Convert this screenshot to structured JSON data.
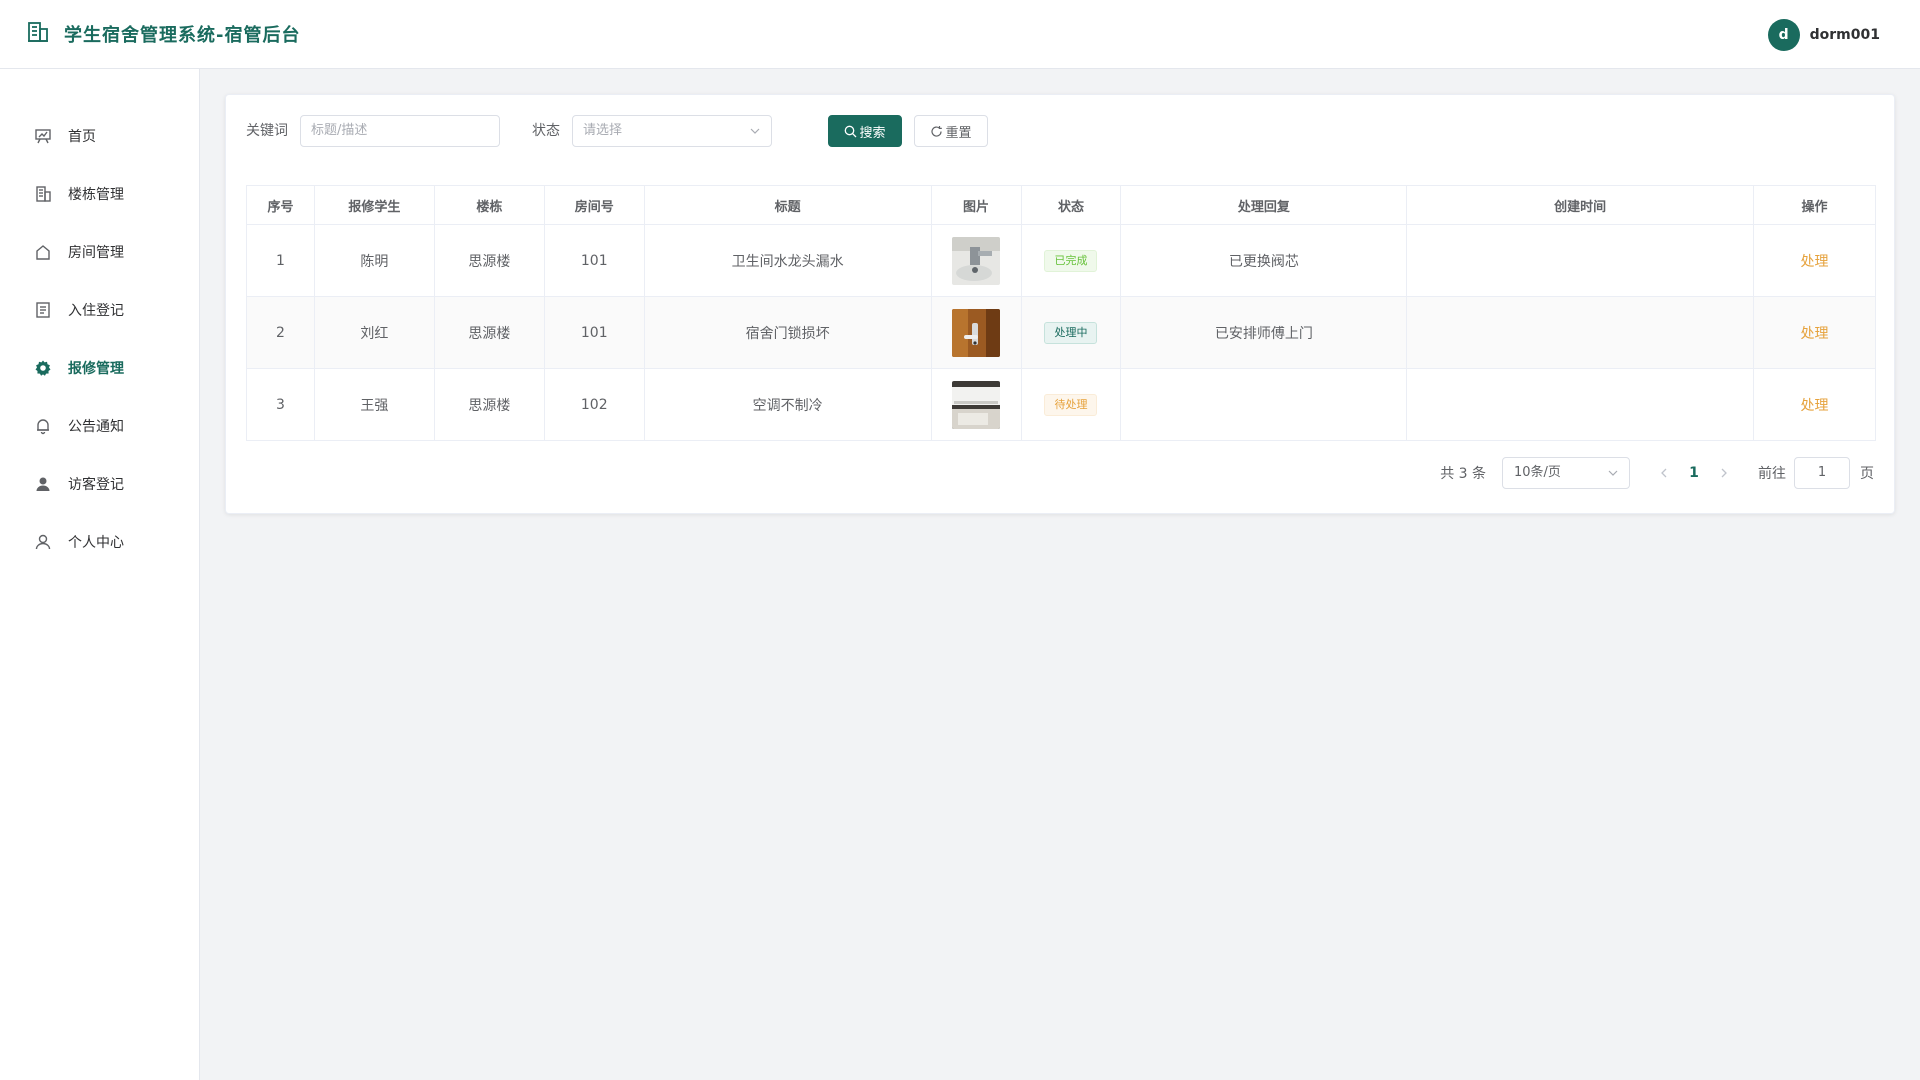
{
  "header": {
    "title": "学生宿舍管理系统-宿管后台",
    "avatar_letter": "d",
    "username": "dorm001"
  },
  "sidebar": {
    "items": [
      {
        "label": "首页",
        "icon": "chart-board-icon",
        "active": false
      },
      {
        "label": "楼栋管理",
        "icon": "building-icon",
        "active": false
      },
      {
        "label": "房间管理",
        "icon": "house-icon",
        "active": false
      },
      {
        "label": "入住登记",
        "icon": "document-icon",
        "active": false
      },
      {
        "label": "报修管理",
        "icon": "gear-icon",
        "active": true
      },
      {
        "label": "公告通知",
        "icon": "bell-icon",
        "active": false
      },
      {
        "label": "访客登记",
        "icon": "user-filled-icon",
        "active": false
      },
      {
        "label": "个人中心",
        "icon": "user-icon",
        "active": false
      }
    ]
  },
  "filter": {
    "keyword_label": "关键词",
    "keyword_placeholder": "标题/描述",
    "status_label": "状态",
    "status_placeholder": "请选择",
    "search_label": "搜索",
    "reset_label": "重置"
  },
  "table": {
    "columns": [
      "序号",
      "报修学生",
      "楼栋",
      "房间号",
      "标题",
      "图片",
      "状态",
      "处理回复",
      "创建时间",
      "操作"
    ],
    "rows": [
      {
        "index": "1",
        "student": "陈明",
        "building": "思源楼",
        "room": "101",
        "title": "卫生间水龙头漏水",
        "image": "faucet-photo",
        "status": "已完成",
        "status_type": "success",
        "reply": "已更换阀芯",
        "created": "",
        "action": "处理"
      },
      {
        "index": "2",
        "student": "刘红",
        "building": "思源楼",
        "room": "101",
        "title": "宿舍门锁损坏",
        "image": "door-lock-photo",
        "status": "处理中",
        "status_type": "processing",
        "reply": "已安排师傅上门",
        "created": "",
        "action": "处理"
      },
      {
        "index": "3",
        "student": "王强",
        "building": "思源楼",
        "room": "102",
        "title": "空调不制冷",
        "image": "air-conditioner-photo",
        "status": "待处理",
        "status_type": "warning",
        "reply": "",
        "created": "",
        "action": "处理"
      }
    ]
  },
  "pagination": {
    "total_text": "共 3 条",
    "page_size": "10条/页",
    "current_page": "1",
    "goto_label": "前往",
    "goto_value": "1",
    "page_unit": "页"
  },
  "colors": {
    "primary": "#1a6b5e",
    "success": "#67c23a",
    "warning": "#e6a23c"
  }
}
